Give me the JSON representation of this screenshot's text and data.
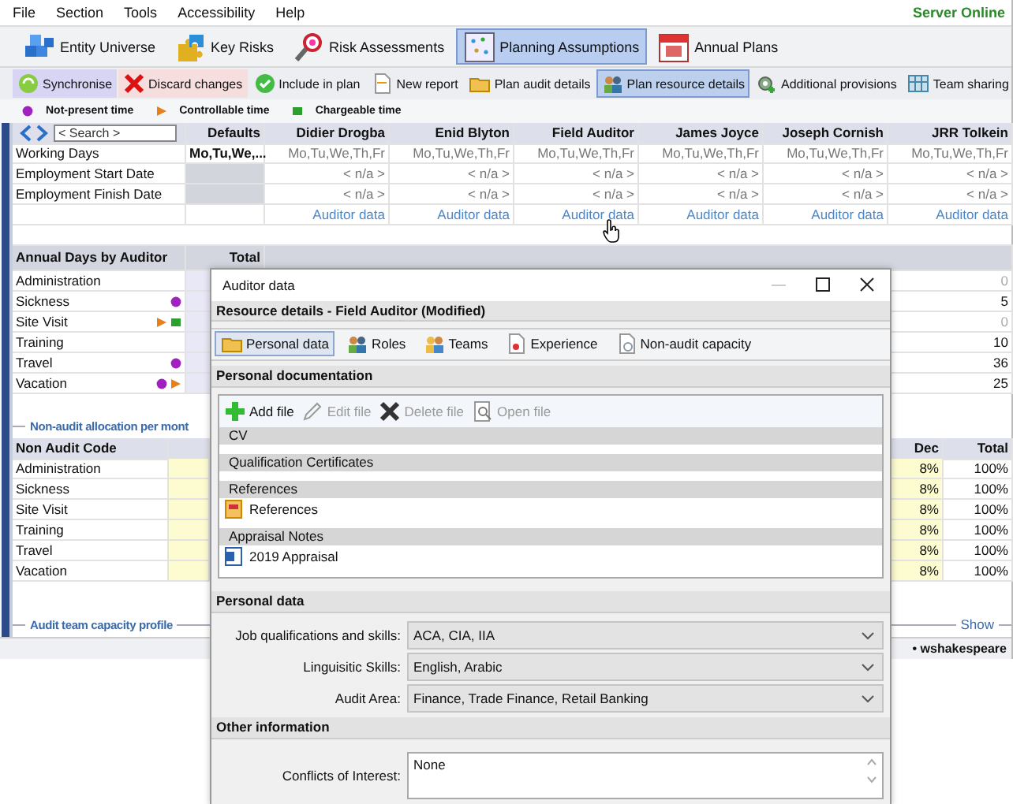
{
  "menu": [
    "File",
    "Section",
    "Tools",
    "Accessibility",
    "Help"
  ],
  "server_status": "Server Online",
  "modules": [
    {
      "label": "Entity Universe",
      "selected": false
    },
    {
      "label": "Key Risks",
      "selected": false
    },
    {
      "label": "Risk Assessments",
      "selected": false
    },
    {
      "label": "Planning Assumptions",
      "selected": true
    },
    {
      "label": "Annual Plans",
      "selected": false
    }
  ],
  "toolbar": [
    {
      "label": "Synchronise",
      "kind": "sync",
      "selected": false
    },
    {
      "label": "Discard changes",
      "kind": "discard",
      "selected": false
    },
    {
      "label": "Include in plan",
      "kind": "plain",
      "selected": false
    },
    {
      "label": "New report",
      "kind": "plain",
      "selected": false
    },
    {
      "label": "Plan audit details",
      "kind": "plain",
      "selected": false
    },
    {
      "label": "Plan resource details",
      "kind": "plain",
      "selected": true
    },
    {
      "label": "Additional provisions",
      "kind": "plain",
      "selected": false
    },
    {
      "label": "Team sharing",
      "kind": "plain",
      "selected": false
    }
  ],
  "legend": [
    {
      "label": "Not-present time",
      "kind": "dot",
      "color": "#a020c0"
    },
    {
      "label": "Controllable time",
      "kind": "triangle",
      "color": "#e8801a"
    },
    {
      "label": "Chargeable time",
      "kind": "square",
      "color": "#2ca02c"
    }
  ],
  "grid": {
    "search_placeholder": "< Search >",
    "defaults_header": "Defaults",
    "auditors": [
      "Didier Drogba",
      "Enid Blyton",
      "Field Auditor",
      "James Joyce",
      "Joseph Cornish",
      "JRR Tolkein"
    ],
    "rows": [
      {
        "label": "Working Days",
        "default": "Mo,Tu,We,...",
        "values": [
          "Mo,Tu,We,Th,Fr",
          "Mo,Tu,We,Th,Fr",
          "Mo,Tu,We,Th,Fr",
          "Mo,Tu,We,Th,Fr",
          "Mo,Tu,We,Th,Fr",
          "Mo,Tu,We,Th,Fr"
        ]
      },
      {
        "label": "Employment Start Date",
        "values": [
          "< n/a >",
          "< n/a >",
          "< n/a >",
          "< n/a >",
          "< n/a >",
          "< n/a >"
        ]
      },
      {
        "label": "Employment Finish Date",
        "values": [
          "< n/a >",
          "< n/a >",
          "< n/a >",
          "< n/a >",
          "< n/a >",
          "< n/a >"
        ]
      }
    ],
    "links": [
      "Auditor data",
      "Auditor data",
      "Auditor data",
      "Auditor data",
      "Auditor data",
      "Auditor data"
    ]
  },
  "annual": {
    "title": "Annual Days by Auditor",
    "total_header": "Total",
    "rows": [
      {
        "label": "Administration",
        "value": "0",
        "muted": true
      },
      {
        "label": "Sickness",
        "not_present": true,
        "value": "5",
        "muted": false
      },
      {
        "label": "Site Visit",
        "controllable": true,
        "chargeable": true,
        "value": "0",
        "muted": true
      },
      {
        "label": "Training",
        "value": "10",
        "muted": false
      },
      {
        "label": "Travel",
        "not_present": true,
        "value": "36",
        "muted": false
      },
      {
        "label": "Vacation",
        "not_present": true,
        "controllable": true,
        "value": "25",
        "muted": false
      }
    ]
  },
  "nonaudit": {
    "title": "Non-audit allocation per mont",
    "code_header": "Non Audit Code",
    "dec_header": "Dec",
    "total_header": "Total",
    "rows": [
      {
        "label": "Administration",
        "dec": "8%",
        "total": "100%"
      },
      {
        "label": "Sickness",
        "dec": "8%",
        "total": "100%"
      },
      {
        "label": "Site Visit",
        "dec": "8%",
        "total": "100%"
      },
      {
        "label": "Training",
        "dec": "8%",
        "total": "100%"
      },
      {
        "label": "Travel",
        "dec": "8%",
        "total": "100%"
      },
      {
        "label": "Vacation",
        "dec": "8%",
        "total": "100%"
      }
    ]
  },
  "capacity": {
    "title": "Audit team capacity profile",
    "show": "Show"
  },
  "status_bar": {
    "user": "• wshakespeare"
  },
  "dialog": {
    "title": "Auditor data",
    "header": "Resource details - Field Auditor (Modified)",
    "tabs": [
      {
        "label": "Personal data",
        "selected": true
      },
      {
        "label": "Roles",
        "selected": false
      },
      {
        "label": "Teams",
        "selected": false
      },
      {
        "label": "Experience",
        "selected": false
      },
      {
        "label": "Non-audit capacity",
        "selected": false
      }
    ],
    "documents": {
      "title": "Personal documentation",
      "actions": [
        {
          "label": "Add file",
          "disabled": false
        },
        {
          "label": "Edit file",
          "disabled": true
        },
        {
          "label": "Delete file",
          "disabled": true
        },
        {
          "label": "Open file",
          "disabled": true
        }
      ],
      "groups": [
        {
          "title": "CV"
        },
        {
          "title": "Qualification Certificates"
        },
        {
          "title": "References",
          "files": [
            "References"
          ]
        },
        {
          "title": "Appraisal Notes",
          "files": [
            "2019 Appraisal"
          ]
        }
      ]
    },
    "personal": {
      "title": "Personal data",
      "fields": [
        {
          "label": "Job qualifications and skills:",
          "value": "ACA, CIA, IIA"
        },
        {
          "label": "Linguisitic Skills:",
          "value": "English, Arabic"
        },
        {
          "label": "Audit Area:",
          "value": "Finance, Trade Finance, Retail Banking"
        }
      ]
    },
    "other": {
      "title": "Other information",
      "fields": [
        {
          "label": "Conflicts of Interest:",
          "value": "None"
        }
      ]
    }
  }
}
